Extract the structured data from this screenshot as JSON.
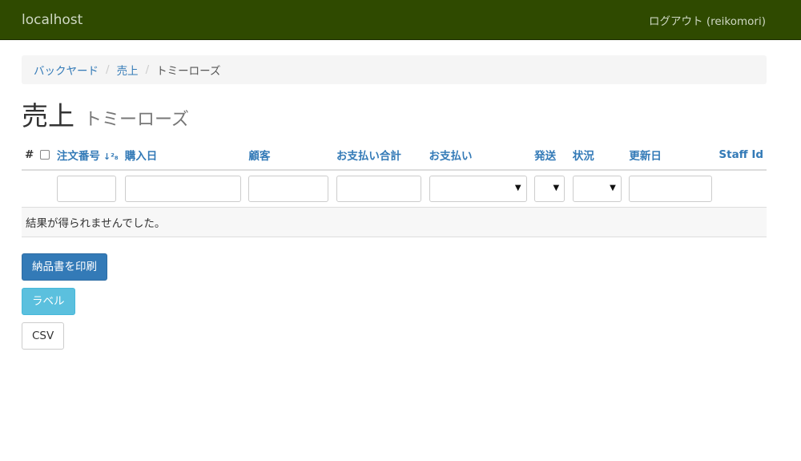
{
  "navbar": {
    "brand": "localhost",
    "logout": "ログアウト (reikomori)"
  },
  "breadcrumb": {
    "items": [
      "バックヤード",
      "売上"
    ],
    "active": "トミーローズ"
  },
  "page": {
    "title": "売上",
    "subtitle": "トミーローズ"
  },
  "table": {
    "headers": {
      "hash": "#",
      "order_no": "注文番号",
      "purchase_date": "購入日",
      "customer": "顧客",
      "payment_total": "お支払い合計",
      "payment": "お支払い",
      "shipping": "発送",
      "status": "状況",
      "updated": "更新日",
      "staff_id": "Staff Id"
    },
    "sort_icon": "↓²₈",
    "empty_message": "結果が得られませんでした。"
  },
  "buttons": {
    "print_invoice": "納品書を印刷",
    "label": "ラベル",
    "csv": "CSV"
  },
  "colors": {
    "navbar": "#2f4a00",
    "link": "#337ab7",
    "primary": "#337ab7",
    "info": "#5bc0de"
  }
}
